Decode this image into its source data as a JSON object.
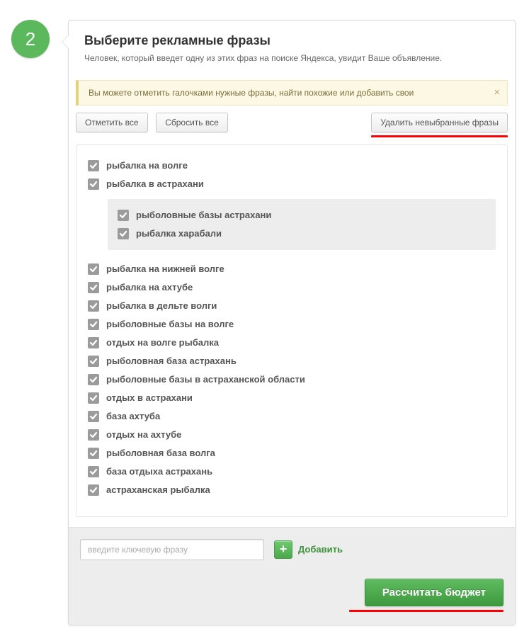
{
  "step_number": "2",
  "header": {
    "title": "Выберите рекламные фразы",
    "subtitle": "Человек, который введет одну из этих фраз на поиске Яндекса, увидит Ваше объявление."
  },
  "infobox": {
    "text": "Вы можете отметить галочками нужные фразы, найти похожие или добавить свои",
    "close": "×"
  },
  "buttons": {
    "mark_all": "Отметить все",
    "reset_all": "Сбросить все",
    "delete_unselected": "Удалить невыбранные фразы"
  },
  "phrases_top": [
    "рыбалка на волге",
    "рыбалка в астрахани"
  ],
  "phrases_sub": [
    "рыболовные базы астрахани",
    "рыбалка харабали"
  ],
  "phrases_rest": [
    "рыбалка на нижней волге",
    "рыбалка на ахтубе",
    "рыбалка в дельте волги",
    "рыболовные базы на волге",
    "отдых на волге рыбалка",
    "рыболовная база астрахань",
    "рыболовные базы в астраханской области",
    "отдых в астрахани",
    "база ахтуба",
    "отдых на ахтубе",
    "рыболовная база волга",
    "база отдыха астрахань",
    "астраханская рыбалка"
  ],
  "add": {
    "placeholder": "введите ключевую фразу",
    "plus": "+",
    "label": "Добавить"
  },
  "calculate_label": "Рассчитать бюджет"
}
